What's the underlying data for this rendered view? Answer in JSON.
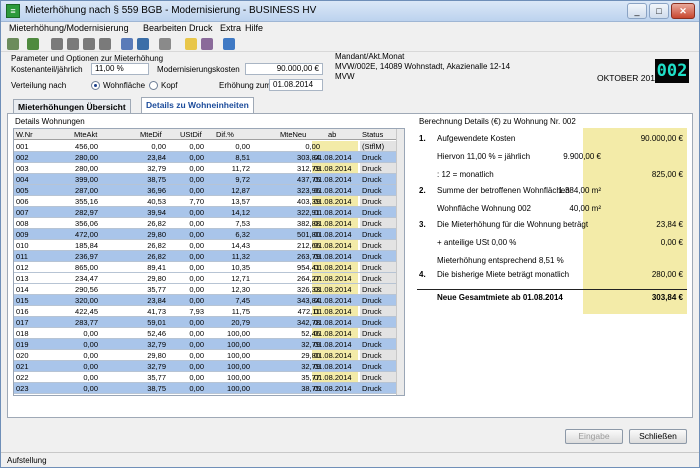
{
  "window": {
    "title": "Mieterhöhung nach § 559 BGB - Modernisierung - BUSINESS HV",
    "icon": "app-icon",
    "min": "_",
    "max": "□",
    "close": "✕"
  },
  "menu": [
    "Mieterhöhung/Modernisierung",
    "Bearbeiten",
    "Druck",
    "Extra",
    "Hilfe"
  ],
  "params": {
    "group_title": "Parameter und Optionen zur Mieterhöhung",
    "kosten_label": "Kostenanteil/jährlich",
    "kosten_value": "11,00 %",
    "modkosten_label": "Modernisierungskosten",
    "modkosten_value": "90.000,00 €",
    "verteilung_label": "Verteilung nach",
    "opt_wohnflaeche": "Wohnfläche",
    "opt_kopf": "Kopf",
    "erhoehung_label": "Erhöhung zum",
    "erhoehung_value": "01.08.2014"
  },
  "mandant": {
    "label": "Mandant/Akt.Monat",
    "line1": "MVW/002E, 14089 Wohnstadt, Akazienalle 12-14",
    "line2": "MVW",
    "month": "OKTOBER 2013",
    "code": "002"
  },
  "tabs": [
    "Mieterhöhungen Übersicht",
    "Details zu Wohneinheiten"
  ],
  "grid": {
    "group_title": "Details Wohnungen",
    "columns": [
      "W.Nr",
      "MteAkt",
      "MteDif",
      "UStDif",
      "Dif.%",
      "MteNeu",
      "ab",
      "Status"
    ],
    "rows": [
      [
        "001",
        "456,00",
        "0,00",
        "0,00",
        "0,00",
        "0,00",
        "",
        "(StflM)"
      ],
      [
        "002",
        "280,00",
        "23,84",
        "0,00",
        "8,51",
        "303,84",
        "01.08.2014",
        "Druck"
      ],
      [
        "003",
        "280,00",
        "32,79",
        "0,00",
        "11,72",
        "312,79",
        "01.08.2014",
        "Druck"
      ],
      [
        "004",
        "399,00",
        "38,75",
        "0,00",
        "9,72",
        "437,75",
        "01.08.2014",
        "Druck"
      ],
      [
        "005",
        "287,00",
        "36,96",
        "0,00",
        "12,87",
        "323,96",
        "01.08.2014",
        "Druck"
      ],
      [
        "006",
        "355,16",
        "40,53",
        "7,70",
        "13,57",
        "403,39",
        "01.08.2014",
        "Druck"
      ],
      [
        "007",
        "282,97",
        "39,94",
        "0,00",
        "14,12",
        "322,91",
        "01.08.2014",
        "Druck"
      ],
      [
        "008",
        "356,06",
        "26,82",
        "0,00",
        "7,53",
        "382,88",
        "01.08.2014",
        "Druck"
      ],
      [
        "009",
        "472,00",
        "29,80",
        "0,00",
        "6,32",
        "501,80",
        "01.08.2014",
        "Druck"
      ],
      [
        "010",
        "185,84",
        "26,82",
        "0,00",
        "14,43",
        "212,66",
        "01.08.2014",
        "Druck"
      ],
      [
        "011",
        "236,97",
        "26,82",
        "0,00",
        "11,32",
        "263,79",
        "01.08.2014",
        "Druck"
      ],
      [
        "012",
        "865,00",
        "89,41",
        "0,00",
        "10,35",
        "954,41",
        "01.08.2014",
        "Druck"
      ],
      [
        "013",
        "234,47",
        "29,80",
        "0,00",
        "12,71",
        "264,27",
        "01.08.2014",
        "Druck"
      ],
      [
        "014",
        "290,56",
        "35,77",
        "0,00",
        "12,30",
        "326,33",
        "01.08.2014",
        "Druck"
      ],
      [
        "015",
        "320,00",
        "23,84",
        "0,00",
        "7,45",
        "343,84",
        "01.08.2014",
        "Druck"
      ],
      [
        "016",
        "422,45",
        "41,73",
        "7,93",
        "11,75",
        "472,11",
        "01.08.2014",
        "Druck"
      ],
      [
        "017",
        "283,77",
        "59,01",
        "0,00",
        "20,79",
        "342,78",
        "01.08.2014",
        "Druck"
      ],
      [
        "018",
        "0,00",
        "52,46",
        "0,00",
        "100,00",
        "52,46",
        "01.08.2014",
        "Druck"
      ],
      [
        "019",
        "0,00",
        "32,79",
        "0,00",
        "100,00",
        "32,79",
        "01.08.2014",
        "Druck"
      ],
      [
        "020",
        "0,00",
        "29,80",
        "0,00",
        "100,00",
        "29,80",
        "01.08.2014",
        "Druck"
      ],
      [
        "021",
        "0,00",
        "32,79",
        "0,00",
        "100,00",
        "32,79",
        "01.08.2014",
        "Druck"
      ],
      [
        "022",
        "0,00",
        "35,77",
        "0,00",
        "100,00",
        "35,77",
        "01.08.2014",
        "Druck"
      ],
      [
        "023",
        "0,00",
        "38,75",
        "0,00",
        "100,00",
        "38,75",
        "01.08.2014",
        "Druck"
      ]
    ]
  },
  "calc": {
    "title": "Berechnung Details (€) zu Wohnung Nr. 002",
    "items": [
      {
        "num": "1.",
        "text": "Aufgewendete Kosten",
        "mid": "",
        "val": "90.000,00 €"
      },
      {
        "num": "",
        "text": "Hiervon 11,00 % = jährlich",
        "mid": "9.900,00 €",
        "val": ""
      },
      {
        "num": "",
        "text": ": 12 = monatlich",
        "mid": "",
        "val": "825,00 €"
      },
      {
        "num": "2.",
        "text": "Summe der betroffenen Wohnflächen",
        "mid": "1.384,00 m²",
        "val": ""
      },
      {
        "num": "",
        "text": "Wohnfläche Wohnung 002",
        "mid": "40,00 m²",
        "val": ""
      },
      {
        "num": "3.",
        "text": "Die Mieterhöhung für die Wohnung beträgt",
        "mid": "",
        "val": "23,84 €"
      },
      {
        "num": "",
        "text": "+ anteilige USt 0,00 %",
        "mid": "",
        "val": "0,00 €"
      },
      {
        "num": "",
        "text": "Mieterhöhung entsprechend 8,51 %",
        "mid": "",
        "val": ""
      },
      {
        "num": "4.",
        "text": "Die bisherige Miete beträgt monatlich",
        "mid": "",
        "val": "280,00 €"
      }
    ],
    "total_label": "Neue Gesamtmiete ab 01.08.2014",
    "total_value": "303,84 €"
  },
  "buttons": {
    "eingabe": "Eingabe",
    "schliessen": "Schließen"
  },
  "status": "Aufstellung"
}
